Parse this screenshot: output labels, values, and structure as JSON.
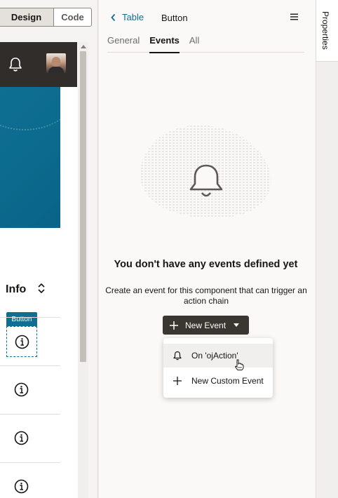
{
  "mode_toggle": {
    "design": "Design",
    "code": "Code"
  },
  "canvas": {
    "info_label": "Info",
    "button_tag": "Button"
  },
  "panel": {
    "back_label": "Table",
    "title": "Button",
    "tabs": [
      {
        "label": "General"
      },
      {
        "label": "Events",
        "active": true
      },
      {
        "label": "All"
      }
    ],
    "empty_title": "You don't have any events defined yet",
    "empty_description": "Create an event for this component that can trigger an action chain",
    "new_event_button": "New Event",
    "dropdown": [
      {
        "label": "On 'ojAction'",
        "icon": "bell-icon"
      },
      {
        "label": "New Custom Event",
        "icon": "plus-icon"
      }
    ]
  },
  "rail": {
    "properties_label": "Properties"
  },
  "colors": {
    "accent": "#0f6f93",
    "header_dark": "#312d2a",
    "button_dark": "#3a3631"
  }
}
